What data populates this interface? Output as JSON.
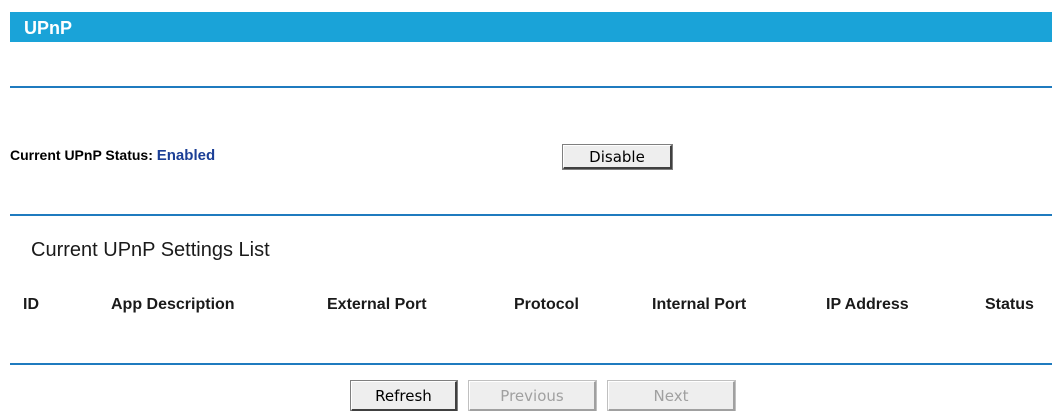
{
  "page": {
    "title": "UPnP"
  },
  "status": {
    "label": "Current UPnP Status:",
    "value": "Enabled",
    "toggle_button_label": "Disable"
  },
  "settings_list": {
    "title": "Current UPnP Settings List",
    "columns": [
      "ID",
      "App Description",
      "External Port",
      "Protocol",
      "Internal Port",
      "IP Address",
      "Status"
    ],
    "rows": []
  },
  "buttons": {
    "refresh": "Refresh",
    "previous": "Previous",
    "next": "Next"
  },
  "colors": {
    "title_bar": "#1aa3d8",
    "divider": "#1f7bbf",
    "status_value": "#1b3f96"
  }
}
